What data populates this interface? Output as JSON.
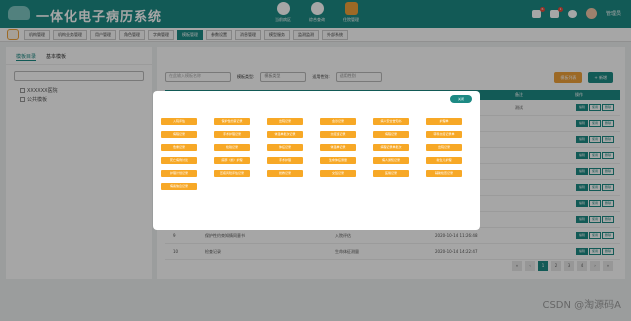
{
  "header": {
    "title": "一体化电子病历系统",
    "nav": [
      "当前病区",
      "综合查询",
      "住院管理"
    ],
    "user": "管理员",
    "badges": [
      "6",
      "1"
    ]
  },
  "tabs": [
    "机构管理",
    "机构业务管理",
    "用户管理",
    "角色管理",
    "字典管理",
    "模板管理",
    "参数设置",
    "消息管理",
    "模型服务",
    "监测监测",
    "外部系统"
  ],
  "left": {
    "sub_tabs": [
      "模板目录",
      "基本模板"
    ],
    "search_placeholder": "",
    "tree": [
      "XXXXXX医院",
      "公共模板"
    ]
  },
  "main": {
    "filters": {
      "template_type_label": "模板类型:",
      "template_type_value": "模板类型",
      "apply_label": "适用性别:",
      "apply_value": "适用性别",
      "search_placeholder": "在此输入模板名称"
    },
    "buttons": {
      "modal": "模板列表",
      "add": "+ 新增"
    },
    "headers": [
      "序号",
      "模板名称",
      "模板类型",
      "创建时间",
      "备注",
      "操作"
    ],
    "rows": [
      {
        "no": "1",
        "name": "",
        "type": "",
        "time": "",
        "note": "测试"
      },
      {
        "no": "2",
        "name": "",
        "type": "",
        "time": "",
        "note": ""
      },
      {
        "no": "3",
        "name": "",
        "type": "",
        "time": "",
        "note": ""
      },
      {
        "no": "4",
        "name": "",
        "type": "",
        "time": "",
        "note": ""
      },
      {
        "no": "5",
        "name": "",
        "type": "",
        "time": "",
        "note": ""
      },
      {
        "no": "6",
        "name": "",
        "type": "",
        "time": "",
        "note": ""
      },
      {
        "no": "7",
        "name": "",
        "type": "",
        "time": "",
        "note": ""
      },
      {
        "no": "8",
        "name": "",
        "type": "",
        "time": "",
        "note": ""
      },
      {
        "no": "9",
        "name": "保护性约束知情同意书",
        "type": "入院评估",
        "time": "2020-10-14 11:26:48",
        "note": ""
      },
      {
        "no": "10",
        "name": "检查记录",
        "type": "生命体征测量",
        "time": "2020-10-14 14:22:47",
        "note": ""
      }
    ],
    "actions": [
      "编辑",
      "使用",
      "删除"
    ],
    "pager": [
      "«",
      "‹",
      "1",
      "2",
      "3",
      "4",
      "›",
      "»"
    ]
  },
  "modal": {
    "close": "关闭",
    "chips": [
      "入院评估",
      "保护性约束记录",
      "出院记录",
      "会诊记录",
      "病人安全告知书",
      "护理单",
      "病程记录",
      "手术护理记录",
      "体温单批次记录",
      "交接班记录",
      "病程记录",
      "转科交接记录单",
      "危重记录",
      "检验记录",
      "体征记录",
      "体温单记录",
      "病程记录单批次",
      "出院记录",
      "死亡病例讨论",
      "麻醉（前）护理",
      "手术护理",
      "生命体征测量",
      "病人通知记录",
      "新生儿护理",
      "护理计划记录",
      "压疮风险评估记录",
      "抢救记录",
      "交班记录",
      "医嘱记录",
      "辅助检查记录",
      "病案信息记录"
    ]
  },
  "watermark": "CSDN @淘源码A"
}
